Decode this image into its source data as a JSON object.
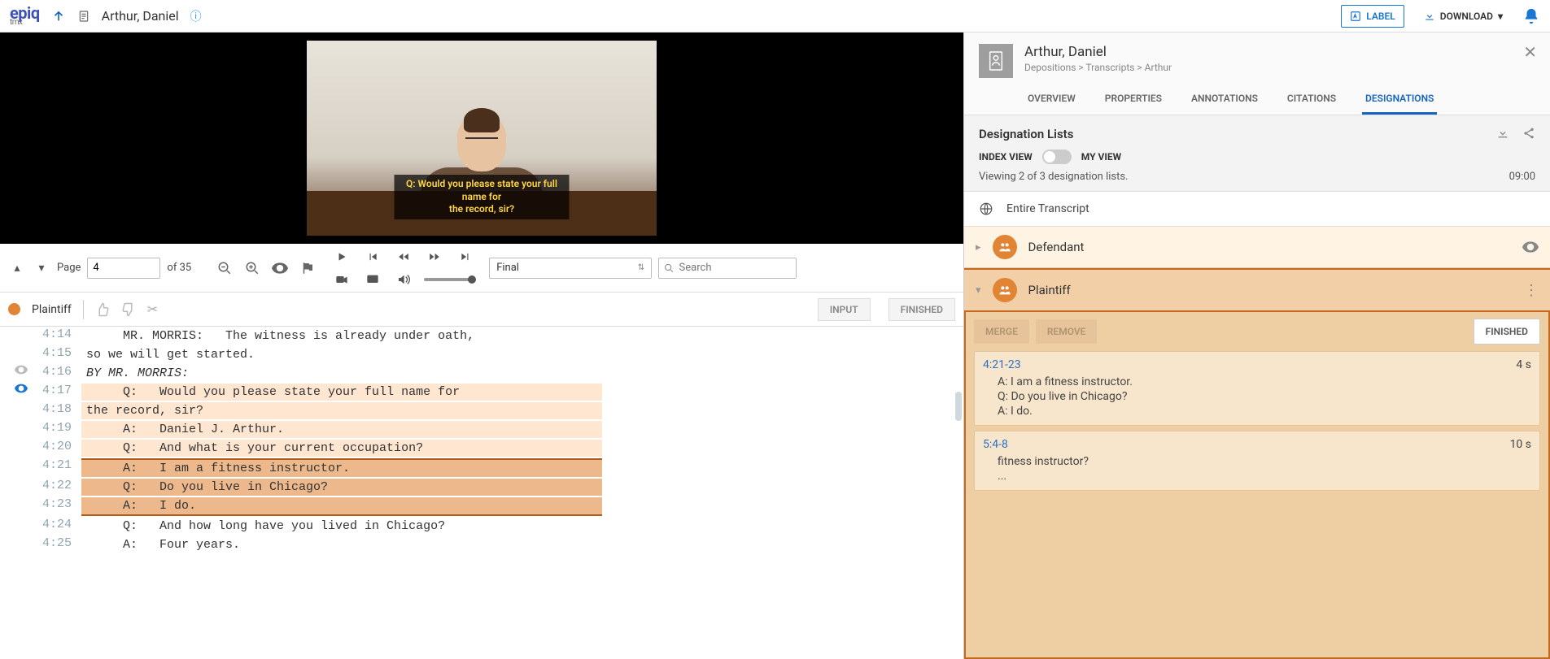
{
  "header": {
    "logo_main": "epiq",
    "logo_sub": "tmx",
    "doc_title": "Arthur, Daniel",
    "label_btn": "LABEL",
    "download_btn": "DOWNLOAD"
  },
  "video": {
    "caption": "Q:   Would you please state your full name for\nthe record, sir?"
  },
  "toolbar": {
    "page_label": "Page",
    "page_value": "4",
    "page_total": "of 35",
    "view_mode": "Final",
    "search_placeholder": "Search"
  },
  "strip": {
    "party": "Plaintiff",
    "party_color": "#e18433",
    "input_btn": "INPUT",
    "finished_btn": "FINISHED"
  },
  "transcript": [
    {
      "ln": "4:14",
      "txt": "     MR. MORRIS:   The witness is already under oath,",
      "cls": ""
    },
    {
      "ln": "4:15",
      "txt": "so we will get started.",
      "cls": ""
    },
    {
      "ln": "4:16",
      "txt": "BY MR. MORRIS:",
      "cls": "italic",
      "eye": "dim"
    },
    {
      "ln": "4:17",
      "txt": "     Q:   Would you please state your full name for",
      "cls": "hl-1",
      "eye": "active"
    },
    {
      "ln": "4:18",
      "txt": "the record, sir?",
      "cls": "hl-1"
    },
    {
      "ln": "4:19",
      "txt": "     A:   Daniel J. Arthur.",
      "cls": "hl-1"
    },
    {
      "ln": "4:20",
      "txt": "     Q:   And what is your current occupation?",
      "cls": "hl-1"
    },
    {
      "ln": "4:21",
      "txt": "     A:   I am a fitness instructor.",
      "cls": "hl-2 hl-2-top"
    },
    {
      "ln": "4:22",
      "txt": "     Q:   Do you live in Chicago?",
      "cls": "hl-2"
    },
    {
      "ln": "4:23",
      "txt": "     A:   I do.",
      "cls": "hl-2 hl-2-bot"
    },
    {
      "ln": "4:24",
      "txt": "     Q:   And how long have you lived in Chicago?",
      "cls": ""
    },
    {
      "ln": "4:25",
      "txt": "     A:   Four years.",
      "cls": ""
    }
  ],
  "panel": {
    "title": "Arthur, Daniel",
    "breadcrumb": "Depositions > Transcripts > Arthur",
    "tabs": [
      "OVERVIEW",
      "PROPERTIES",
      "ANNOTATIONS",
      "CITATIONS",
      "DESIGNATIONS"
    ],
    "active_tab": 4,
    "section_title": "Designation Lists",
    "index_view": "INDEX VIEW",
    "my_view": "MY VIEW",
    "viewing": "Viewing 2 of 3 designation lists.",
    "total_time": "09:00",
    "entire": "Entire Transcript",
    "defendant": "Defendant",
    "defendant_color": "#e18433",
    "plaintiff": "Plaintiff",
    "plaintiff_color": "#e18433",
    "merge": "MERGE",
    "remove": "REMOVE",
    "finished": "FINISHED",
    "clips": [
      {
        "ref": "4:21-23",
        "dur": "4 s",
        "lines": [
          "A: I am a fitness instructor.",
          "Q: Do you live in Chicago?",
          "A: I do."
        ]
      },
      {
        "ref": "5:4-8",
        "dur": "10 s",
        "lines": [
          "fitness instructor?",
          "..."
        ]
      }
    ]
  }
}
